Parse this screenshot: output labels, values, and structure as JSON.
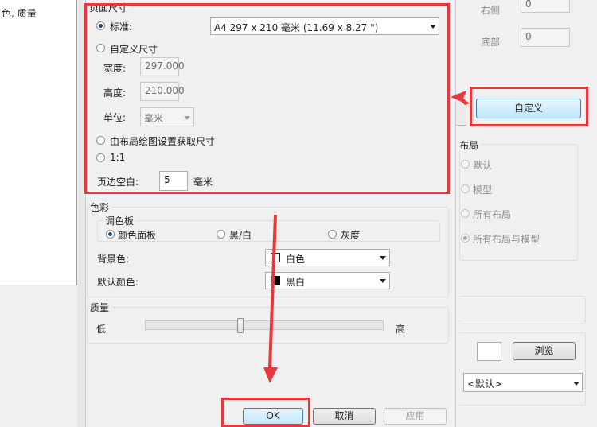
{
  "left_panel": {
    "list_item": "色, 质量"
  },
  "page_size": {
    "group_title": "页面尺寸",
    "standard_label": "标准:",
    "standard_value": "A4 297 x 210 毫米 (11.69 x 8.27 \")",
    "custom_label": "自定义尺寸",
    "width_label": "宽度:",
    "width_value": "297.000",
    "height_label": "高度:",
    "height_value": "210.000",
    "unit_label": "单位:",
    "unit_value": "毫米",
    "from_layout_label": "由布局绘图设置获取尺寸",
    "one_to_one_label": "1:1",
    "margin_label": "页边空白:",
    "margin_value": "5",
    "margin_unit": "毫米"
  },
  "color": {
    "group_title": "色彩",
    "palette_title": "调色板",
    "options": [
      "颜色面板",
      "黑/白",
      "灰度"
    ],
    "bg_label": "背景色:",
    "bg_value": "白色",
    "default_label": "默认颜色:",
    "default_value": "黑白",
    "swatch_white": "#ffffff",
    "swatch_black": "#000000"
  },
  "quality": {
    "group_title": "质量",
    "low": "低",
    "high": "高",
    "level": 0.4
  },
  "buttons": {
    "ok": "OK",
    "cancel": "取消",
    "apply": "应用"
  },
  "right": {
    "right_label": "右侧",
    "right_value": "0",
    "bottom_label": "底部",
    "bottom_value": "0",
    "custom_button": "自定义",
    "layout_title": "布局",
    "layout_options": [
      "默认",
      "模型",
      "所有布局",
      "所有布局与模型"
    ],
    "browse_button": "浏览",
    "default_select": "<默认>"
  },
  "accent_color": "#e8383d"
}
